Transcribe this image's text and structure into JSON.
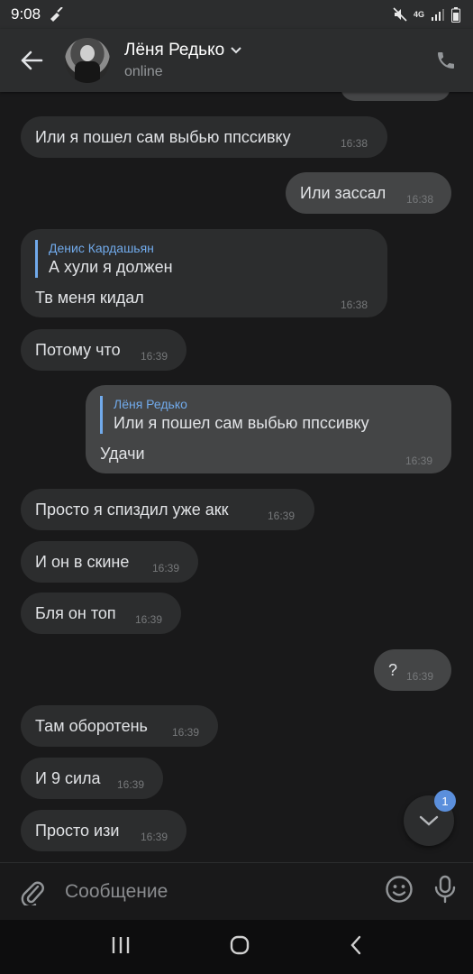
{
  "status_bar": {
    "time": "9:08",
    "network": "4G"
  },
  "header": {
    "name": "Лёня Редько",
    "status": "online"
  },
  "messages": [
    {
      "text": "Или я пошел сам выбью ппссивку",
      "time": "16:38"
    },
    {
      "text": "Или зассал",
      "time": "16:38"
    },
    {
      "reply_name": "Денис Кардашьян",
      "reply_text": "А хули я должен",
      "text": "Тв меня кидал",
      "time": "16:38"
    },
    {
      "text": "Потому что",
      "time": "16:39"
    },
    {
      "reply_name": "Лёня Редько",
      "reply_text": "Или я пошел сам выбью ппссивку",
      "text": "Удачи",
      "time": "16:39"
    },
    {
      "text": "Просто я спиздил уже акк",
      "time": "16:39"
    },
    {
      "text": "И он в скине",
      "time": "16:39"
    },
    {
      "text": "Бля он топ",
      "time": "16:39"
    },
    {
      "text": "?",
      "time": "16:39"
    },
    {
      "text": "Там оборотень",
      "time": "16:39"
    },
    {
      "text": "И 9 сила",
      "time": "16:39"
    },
    {
      "text": "Просто изи",
      "time": "16:39"
    }
  ],
  "scroll_down": {
    "badge": "1"
  },
  "composer": {
    "placeholder": "Сообщение"
  },
  "icons": {
    "back": "arrow-left-icon",
    "call": "phone-icon",
    "attach": "paperclip-icon",
    "emoji": "smile-icon",
    "mic": "microphone-icon",
    "scroll": "chevron-down-icon"
  },
  "colors": {
    "background": "#19191a",
    "bubble_in": "#2c2d2e",
    "bubble_out": "#444546",
    "accent": "#71aaeb",
    "badge": "#5b8fdc"
  }
}
